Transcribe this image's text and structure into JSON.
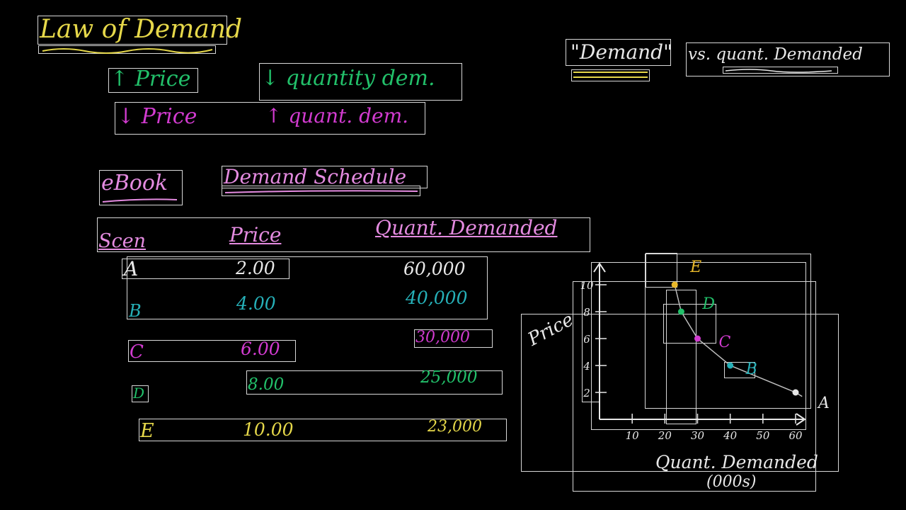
{
  "title": "Law of Demand",
  "rules": [
    {
      "price": "↑ Price",
      "qty": "↓ quantity dem."
    },
    {
      "price": "↓ Price",
      "qty": "↑ quant. dem."
    }
  ],
  "demand_label": "\"Demand\"",
  "vs_label": "vs. quant. Demanded",
  "ebook_label": "eBook",
  "schedule_title": "Demand Schedule",
  "table": {
    "headers": [
      "Scen",
      "Price",
      "Quant. Demanded"
    ],
    "rows": [
      {
        "scen": "A",
        "price": "2.00",
        "qty": "60,000"
      },
      {
        "scen": "B",
        "price": "4.00",
        "qty": "40,000"
      },
      {
        "scen": "C",
        "price": "6.00",
        "qty": "30,000"
      },
      {
        "scen": "D",
        "price": "8.00",
        "qty": "25,000"
      },
      {
        "scen": "E",
        "price": "10.00",
        "qty": "23,000"
      }
    ]
  },
  "colors": {
    "yellow": "#e6d84a",
    "green": "#22c06a",
    "magenta": "#d23bd0",
    "pink": "#e48be0",
    "teal": "#26b0b8",
    "white": "#e8e8e8",
    "gold": "#e8b82a"
  },
  "chart_data": {
    "type": "line",
    "xlabel": "Quant. Demanded",
    "xlabel_unit": "(000s)",
    "ylabel": "Price",
    "x_ticks": [
      "10",
      "20",
      "30",
      "40",
      "50",
      "60"
    ],
    "y_ticks": [
      "2",
      "4",
      "6",
      "8",
      "10"
    ],
    "xlim": [
      0,
      60
    ],
    "ylim": [
      0,
      10
    ],
    "points": [
      {
        "label": "A",
        "x": 60,
        "y": 2,
        "color": "#e8e8e8"
      },
      {
        "label": "B",
        "x": 40,
        "y": 4,
        "color": "#26b0b8"
      },
      {
        "label": "C",
        "x": 30,
        "y": 6,
        "color": "#d23bd0"
      },
      {
        "label": "D",
        "x": 25,
        "y": 8,
        "color": "#22c06a"
      },
      {
        "label": "E",
        "x": 23,
        "y": 10,
        "color": "#e8b82a"
      }
    ]
  }
}
